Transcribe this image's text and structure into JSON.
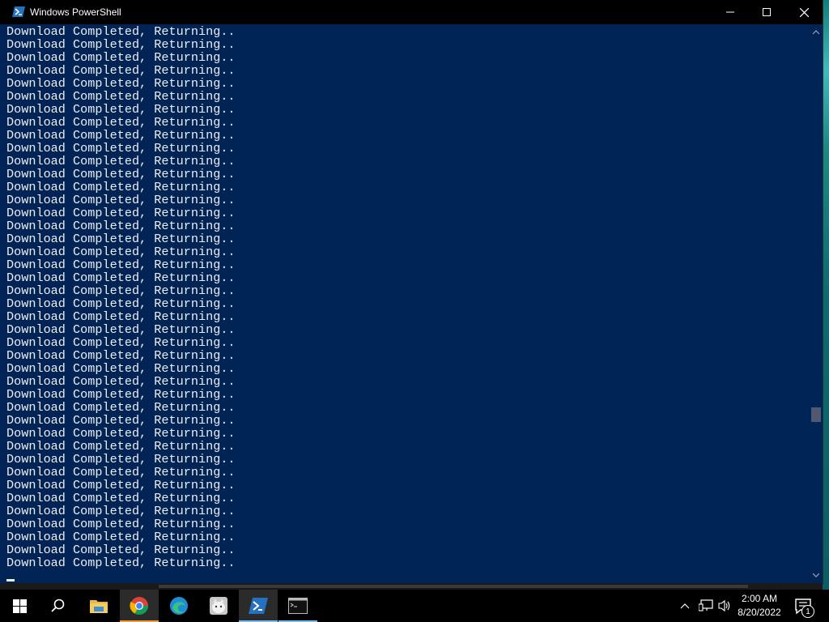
{
  "window": {
    "title": "Windows PowerShell"
  },
  "console": {
    "lines": [
      "Download Completed, Returning..",
      "Download Completed, Returning..",
      "Download Completed, Returning..",
      "Download Completed, Returning..",
      "Download Completed, Returning..",
      "Download Completed, Returning..",
      "Download Completed, Returning..",
      "Download Completed, Returning..",
      "Download Completed, Returning..",
      "Download Completed, Returning..",
      "Download Completed, Returning..",
      "Download Completed, Returning..",
      "Download Completed, Returning..",
      "Download Completed, Returning..",
      "Download Completed, Returning..",
      "Download Completed, Returning..",
      "Download Completed, Returning..",
      "Download Completed, Returning..",
      "Download Completed, Returning..",
      "Download Completed, Returning..",
      "Download Completed, Returning..",
      "Download Completed, Returning..",
      "Download Completed, Returning..",
      "Download Completed, Returning..",
      "Download Completed, Returning..",
      "Download Completed, Returning..",
      "Download Completed, Returning..",
      "Download Completed, Returning..",
      "Download Completed, Returning..",
      "Download Completed, Returning..",
      "Download Completed, Returning..",
      "Download Completed, Returning..",
      "Download Completed, Returning..",
      "Download Completed, Returning..",
      "Download Completed, Returning..",
      "Download Completed, Returning..",
      "Download Completed, Returning..",
      "Download Completed, Returning..",
      "Download Completed, Returning..",
      "Download Completed, Returning..",
      "Download Completed, Returning..",
      "Download Completed, Returning.."
    ]
  },
  "taskbar": {
    "items": [
      {
        "name": "start-button",
        "icon": "windows-logo-icon"
      },
      {
        "name": "search-button",
        "icon": "search-icon"
      },
      {
        "name": "file-explorer",
        "icon": "folder-icon"
      },
      {
        "name": "chrome",
        "icon": "chrome-icon"
      },
      {
        "name": "edge",
        "icon": "edge-icon"
      },
      {
        "name": "app-cat",
        "icon": "cat-app-icon"
      },
      {
        "name": "powershell",
        "icon": "powershell-icon"
      },
      {
        "name": "command-prompt",
        "icon": "cmd-icon"
      }
    ],
    "clock": {
      "time": "2:00 AM",
      "date": "8/20/2022"
    },
    "notification_count": "1"
  },
  "colors": {
    "console_bg": "#012456",
    "console_text": "#eeedf0",
    "titlebar": "#000000",
    "taskbar": "#000000",
    "chrome_accent": "#f09a3c",
    "active_underline": "#76b9ed"
  }
}
